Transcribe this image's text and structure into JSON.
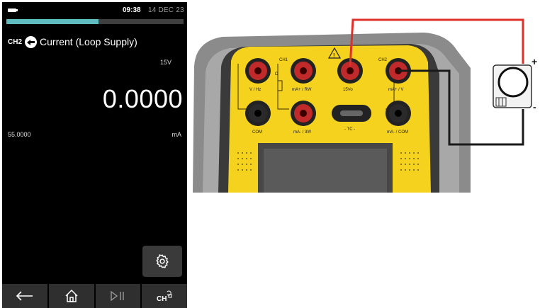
{
  "status": {
    "time": "09:38",
    "date": "14 DEC 23",
    "progress": 0.52
  },
  "header": {
    "channel": "CH2",
    "mode_icon": "current-source-icon",
    "title": "Current (Loop Supply)"
  },
  "measurement": {
    "supply_voltage": "15V",
    "value": "0.0000",
    "range": "55.0000",
    "unit": "mA"
  },
  "buttons": {
    "settings_icon": "gear-icon"
  },
  "navbar": [
    "back-arrow-icon",
    "home-icon",
    "play-pause-icon",
    "channel-select-icon"
  ],
  "device_labels": {
    "ch1": "CH1",
    "ch2": "CH2",
    "v_hz": "V / Hz",
    "ma_rw": "mA+ / RW",
    "v24": "15Vo",
    "ma_v": "mA+ / V",
    "com": "COM",
    "ma_3w": "mA- / 3W",
    "tc": "- TC -",
    "ma_com": "mA- / COM",
    "ohm_symbol": "Ω",
    "plus": "+",
    "minus": "-"
  },
  "colors": {
    "accent": "#5fbdc2",
    "wire_red": "#e0302a",
    "wire_black": "#1a1a1a",
    "panel_yellow": "#f5d21d"
  }
}
